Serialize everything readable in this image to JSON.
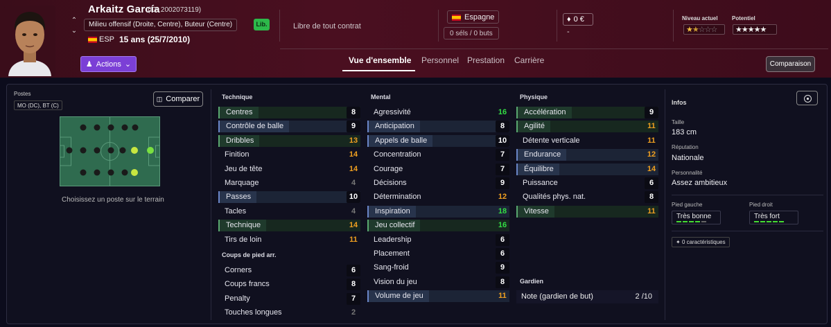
{
  "player": {
    "name": "Arkaitz García",
    "id_text": "(ID: 2002073119)",
    "roles": "Milieu offensif (Droite, Centre), Buteur (Centre)",
    "nationality_code": "ESP",
    "age_text": "15 ans (25/7/2010)",
    "contract_badge": "Lib.",
    "contract_text": "Libre de tout contrat",
    "club_country": "Espagne",
    "selections": "0 séls / 0 buts",
    "value": "0 €",
    "value_sub": "-",
    "current_ability_label": "Niveau actuel",
    "potential_label": "Potentiel",
    "current_stars": 1.5,
    "potential_stars": 5,
    "colors": {
      "flag_red": "#c60b1e",
      "flag_yellow": "#ffc400",
      "accent": "#7b3fd6"
    }
  },
  "toolbar": {
    "actions_label": "Actions",
    "comparison_label": "Comparaison",
    "tabs": [
      "Vue d'ensemble",
      "Personnel",
      "Prestation",
      "Carrière"
    ]
  },
  "positions": {
    "label": "Postes",
    "value": "MO (DC), BT (C)",
    "compare_label": "Comparer",
    "hint": "Choisissez un poste sur le terrain"
  },
  "technique": {
    "title": "Technique",
    "rows": [
      {
        "label": "Centres",
        "value": 8,
        "hl": "green",
        "tone": "white"
      },
      {
        "label": "Contrôle de balle",
        "value": 9,
        "hl": "blue",
        "tone": "white"
      },
      {
        "label": "Dribbles",
        "value": 13,
        "hl": "green",
        "tone": "orange"
      },
      {
        "label": "Finition",
        "value": 14,
        "hl": "",
        "tone": "orange"
      },
      {
        "label": "Jeu de tête",
        "value": 14,
        "hl": "",
        "tone": "orange"
      },
      {
        "label": "Marquage",
        "value": 4,
        "hl": "",
        "tone": "gray"
      },
      {
        "label": "Passes",
        "value": 10,
        "hl": "blue",
        "tone": "white"
      },
      {
        "label": "Tacles",
        "value": 4,
        "hl": "",
        "tone": "gray"
      },
      {
        "label": "Technique",
        "value": 14,
        "hl": "green",
        "tone": "orange"
      },
      {
        "label": "Tirs de loin",
        "value": 11,
        "hl": "",
        "tone": "orange"
      }
    ]
  },
  "setpieces": {
    "title": "Coups de pied arr.",
    "rows": [
      {
        "label": "Corners",
        "value": 6,
        "hl": "",
        "tone": "white"
      },
      {
        "label": "Coups francs",
        "value": 8,
        "hl": "",
        "tone": "white"
      },
      {
        "label": "Penalty",
        "value": 7,
        "hl": "",
        "tone": "white"
      },
      {
        "label": "Touches longues",
        "value": 2,
        "hl": "",
        "tone": "gray"
      }
    ]
  },
  "mental": {
    "title": "Mental",
    "rows": [
      {
        "label": "Agressivité",
        "value": 16,
        "hl": "",
        "tone": "green"
      },
      {
        "label": "Anticipation",
        "value": 8,
        "hl": "blue",
        "tone": "white"
      },
      {
        "label": "Appels de balle",
        "value": 10,
        "hl": "blue",
        "tone": "white"
      },
      {
        "label": "Concentration",
        "value": 7,
        "hl": "",
        "tone": "white"
      },
      {
        "label": "Courage",
        "value": 7,
        "hl": "",
        "tone": "white"
      },
      {
        "label": "Décisions",
        "value": 9,
        "hl": "",
        "tone": "white"
      },
      {
        "label": "Détermination",
        "value": 12,
        "hl": "",
        "tone": "orange"
      },
      {
        "label": "Inspiration",
        "value": 18,
        "hl": "blue",
        "tone": "green"
      },
      {
        "label": "Jeu collectif",
        "value": 16,
        "hl": "green",
        "tone": "green"
      },
      {
        "label": "Leadership",
        "value": 6,
        "hl": "",
        "tone": "white"
      },
      {
        "label": "Placement",
        "value": 6,
        "hl": "",
        "tone": "white"
      },
      {
        "label": "Sang-froid",
        "value": 9,
        "hl": "",
        "tone": "white"
      },
      {
        "label": "Vision du jeu",
        "value": 8,
        "hl": "",
        "tone": "white"
      },
      {
        "label": "Volume de jeu",
        "value": 11,
        "hl": "blue",
        "tone": "orange"
      }
    ]
  },
  "physical": {
    "title": "Physique",
    "rows": [
      {
        "label": "Accélération",
        "value": 9,
        "hl": "green",
        "tone": "white"
      },
      {
        "label": "Agilité",
        "value": 11,
        "hl": "green",
        "tone": "orange"
      },
      {
        "label": "Détente verticale",
        "value": 11,
        "hl": "",
        "tone": "orange"
      },
      {
        "label": "Endurance",
        "value": 12,
        "hl": "blue",
        "tone": "orange"
      },
      {
        "label": "Équilibre",
        "value": 14,
        "hl": "blue",
        "tone": "orange"
      },
      {
        "label": "Puissance",
        "value": 6,
        "hl": "",
        "tone": "white"
      },
      {
        "label": "Qualités phys. nat.",
        "value": 8,
        "hl": "",
        "tone": "white"
      },
      {
        "label": "Vitesse",
        "value": 11,
        "hl": "green",
        "tone": "orange"
      }
    ]
  },
  "goalkeeper": {
    "title": "Gardien",
    "label": "Note (gardien de but)",
    "value": "2 /10"
  },
  "infos": {
    "title": "Infos",
    "height_label": "Taille",
    "height": "183 cm",
    "reputation_label": "Réputation",
    "reputation": "Nationale",
    "personality_label": "Personnalité",
    "personality": "Assez ambitieux",
    "left_foot_label": "Pied gauche",
    "left_foot": "Très bonne",
    "left_foot_level": 4,
    "right_foot_label": "Pied droit",
    "right_foot": "Très fort",
    "right_foot_level": 5,
    "traits": "0 caractéristiques"
  }
}
